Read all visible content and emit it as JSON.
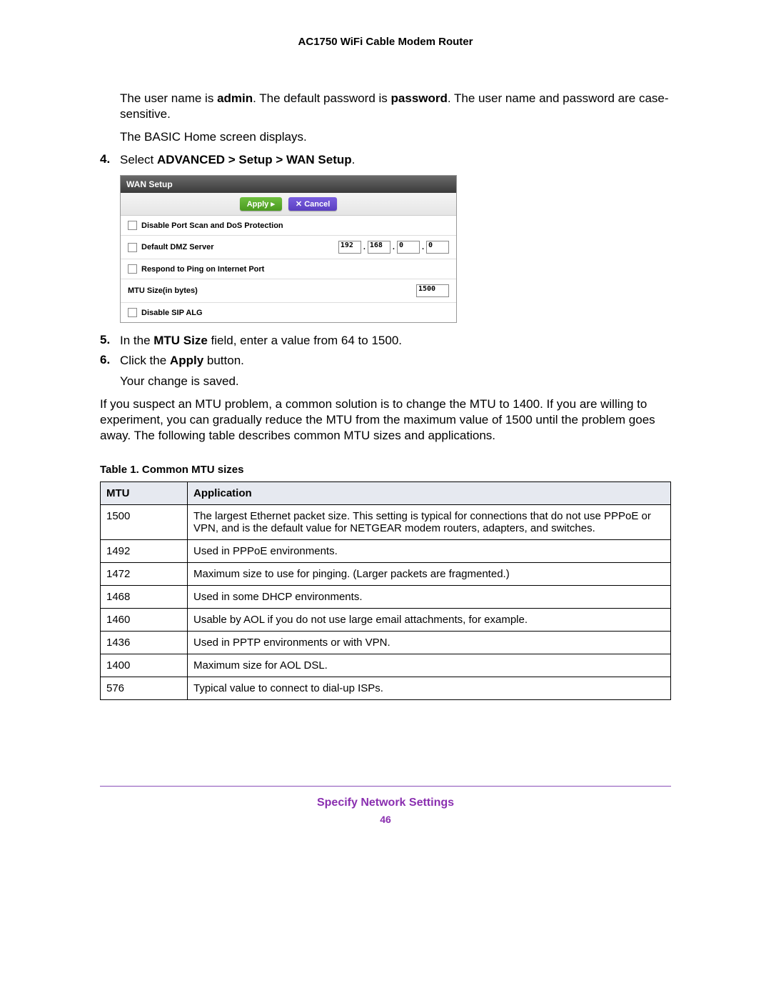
{
  "doc_title": "AC1750 WiFi Cable Modem Router",
  "intro": {
    "p1_a": "The user name is ",
    "p1_b": "admin",
    "p1_c": ". The default password is ",
    "p1_d": "password",
    "p1_e": ". The user name and password are case-sensitive.",
    "p2": "The BASIC Home screen displays."
  },
  "steps": {
    "s4_num": "4.",
    "s4_a": "Select ",
    "s4_b": "ADVANCED > Setup > WAN Setup",
    "s4_c": ".",
    "s5_num": "5.",
    "s5_a": "In the ",
    "s5_b": "MTU Size",
    "s5_c": " field, enter a value from 64 to 1500.",
    "s6_num": "6.",
    "s6_a": "Click the ",
    "s6_b": "Apply",
    "s6_c": " button.",
    "s6_after": "Your change is saved."
  },
  "wan": {
    "title": "WAN Setup",
    "apply": "Apply ▸",
    "cancel": "✕ Cancel",
    "row1": "Disable Port Scan and DoS Protection",
    "row2": "Default DMZ Server",
    "ip": [
      "192",
      "168",
      "0",
      "0"
    ],
    "row3": "Respond to Ping on Internet Port",
    "row4": "MTU Size(in bytes)",
    "mtu_value": "1500",
    "row5": "Disable SIP ALG"
  },
  "para_after": "If you suspect an MTU problem, a common solution is to change the MTU to 1400. If you are willing to experiment, you can gradually reduce the MTU from the maximum value of 1500 until the problem goes away. The following table describes common MTU sizes and applications.",
  "table": {
    "caption": "Table 1.  Common MTU sizes",
    "head_mtu": "MTU",
    "head_app": "Application",
    "rows": [
      {
        "mtu": "1500",
        "app": "The largest Ethernet packet size. This setting is typical for connections that do not use PPPoE or VPN, and is the default value for NETGEAR modem routers, adapters, and switches."
      },
      {
        "mtu": "1492",
        "app": "Used in PPPoE environments."
      },
      {
        "mtu": "1472",
        "app": "Maximum size to use for pinging. (Larger packets are fragmented.)"
      },
      {
        "mtu": "1468",
        "app": "Used in some DHCP environments."
      },
      {
        "mtu": "1460",
        "app": "Usable by AOL if you do not use large email attachments, for example."
      },
      {
        "mtu": "1436",
        "app": "Used in PPTP environments or with VPN."
      },
      {
        "mtu": "1400",
        "app": "Maximum size for AOL DSL."
      },
      {
        "mtu": "576",
        "app": "Typical value to connect to dial-up ISPs."
      }
    ]
  },
  "footer": {
    "section": "Specify Network Settings",
    "page": "46"
  }
}
